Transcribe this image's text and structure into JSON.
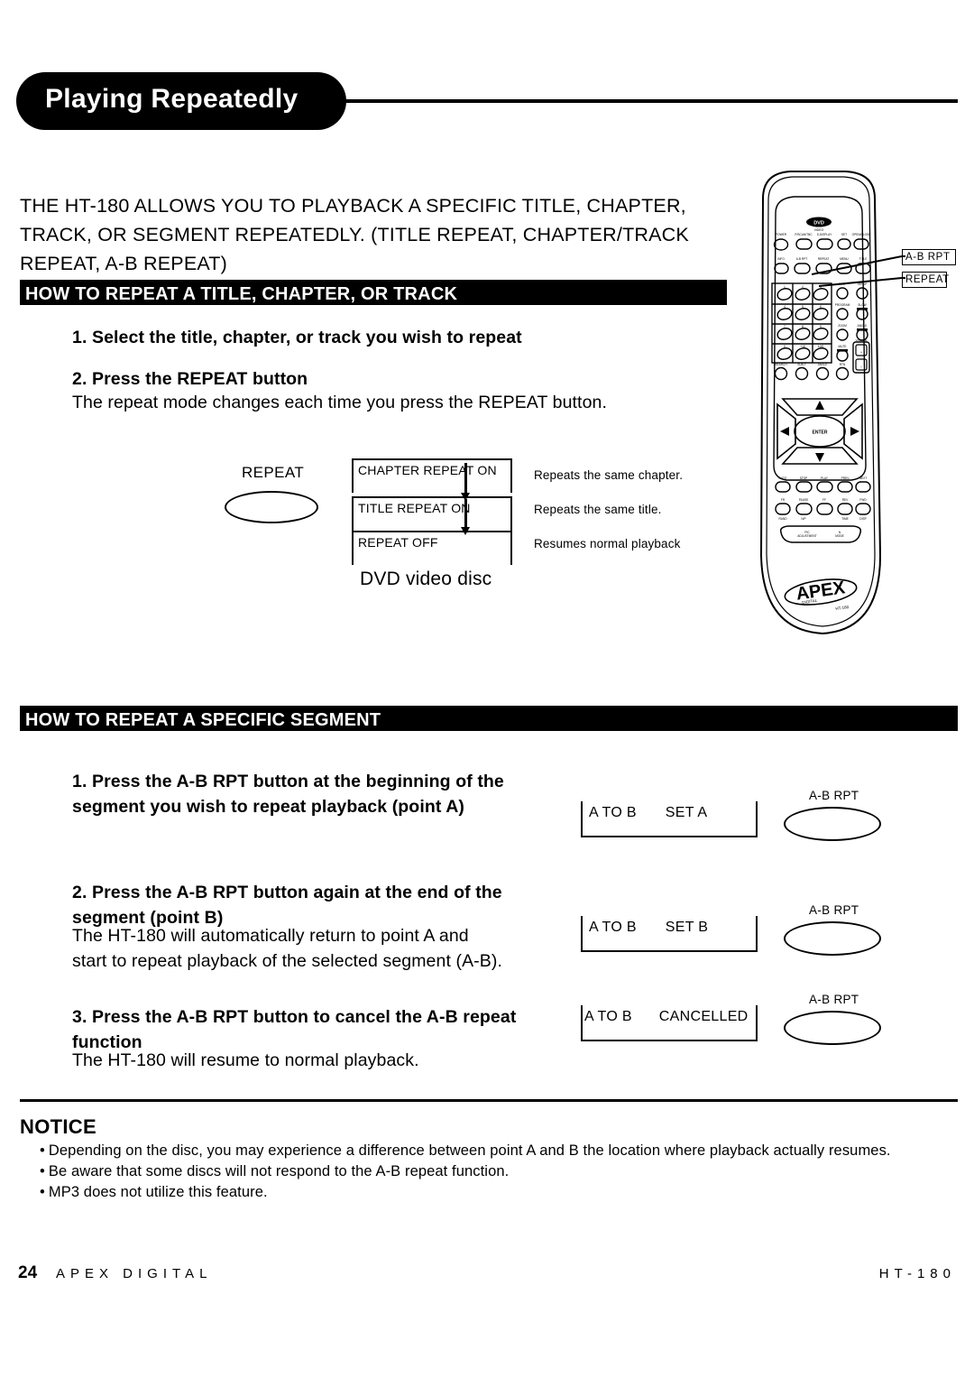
{
  "page": {
    "title": "Playing Repeatedly",
    "intro_lines": [
      "THE HT-180 ALLOWS YOU TO PLAYBACK A SPECIFIC TITLE, CHAPTER,",
      "TRACK, OR SEGMENT REPEATEDLY. (TITLE REPEAT, CHAPTER/TRACK",
      "REPEAT, A-B REPEAT)"
    ]
  },
  "section1": {
    "header": "HOW TO REPEAT A TITLE, CHAPTER, OR TRACK",
    "step1": "1. Select the title, chapter, or track you wish to repeat",
    "step2": "2. Press the REPEAT button",
    "step2_note": "The repeat mode changes each time you press the REPEAT button.",
    "diagram": {
      "button_label": "REPEAT",
      "caption": "DVD video disc",
      "states": [
        {
          "display": "CHAPTER REPEAT ON",
          "description": "Repeats the same chapter."
        },
        {
          "display": "TITLE REPEAT ON",
          "description": "Repeats the same title."
        },
        {
          "display": "REPEAT OFF",
          "description": "Resumes normal playback"
        }
      ]
    }
  },
  "section2": {
    "header": "HOW TO REPEAT A SPECIFIC SEGMENT",
    "step1": "1. Press the A-B RPT button at the beginning of the segment you wish to repeat playback (point A)",
    "step2": "2. Press the A-B RPT button again at the end of the segment (point B)",
    "step2_note_line1": "The HT-180 will automatically return to point A and",
    "step2_note_line2": "start to repeat playback of the selected segment (A-B).",
    "step3": "3. Press the A-B RPT button to cancel the A-B repeat function",
    "step3_note": "The HT-180 will resume to normal playback.",
    "displays": [
      {
        "left": "A TO B",
        "right": "SET A",
        "button_label": "A-B RPT"
      },
      {
        "left": "A TO B",
        "right": "SET B",
        "button_label": "A-B RPT"
      },
      {
        "left": "A TO B",
        "right": "CANCELLED",
        "button_label": "A-B RPT"
      }
    ]
  },
  "notice": {
    "title": "NOTICE",
    "bullet_char": "•",
    "items": [
      "Depending on the disc, you may experience a difference between point A and B the location where playback actually resumes.",
      "Be aware that some discs will not respond to the A-B repeat function.",
      "MP3 does not utilize this feature."
    ]
  },
  "remote": {
    "callout_abrpt": "A-B RPT",
    "callout_repeat": "REPEAT",
    "logo_text": "APEX",
    "logo_sub": "DIGITAL",
    "enter_label": "ENTER"
  },
  "footer": {
    "page_number": "24",
    "brand": "APEX DIGITAL",
    "model": "HT-180"
  },
  "colors": {
    "ink": "#000000",
    "paper": "#ffffff"
  }
}
